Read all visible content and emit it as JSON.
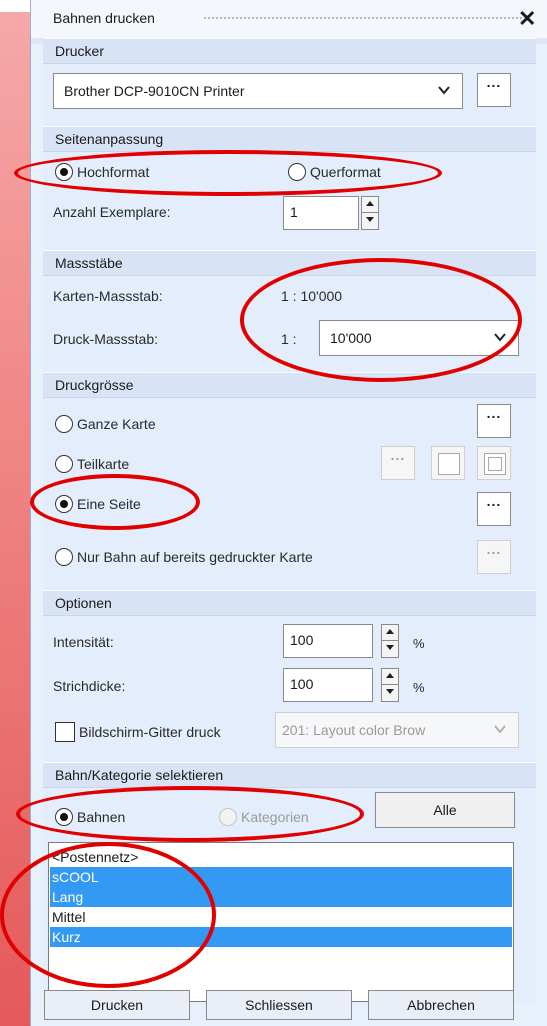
{
  "window": {
    "title": "Bahnen drucken"
  },
  "printer": {
    "section_title": "Drucker",
    "selected": "Brother DCP-9010CN Printer",
    "more_label": "..."
  },
  "page_setup": {
    "section_title": "Seitenanpassung",
    "portrait_label": "Hochformat",
    "landscape_label": "Querformat",
    "orientation_selected": "portrait",
    "copies_label": "Anzahl Exemplare:",
    "copies_value": "1"
  },
  "scales": {
    "section_title": "Massstäbe",
    "map_scale_label": "Karten-Massstab:",
    "map_scale_value": "1 : 10'000",
    "print_scale_label": "Druck-Massstab:",
    "print_scale_prefix": "1 :",
    "print_scale_value": "10'000"
  },
  "print_size": {
    "section_title": "Druckgrösse",
    "whole_map_label": "Ganze Karte",
    "partial_map_label": "Teilkarte",
    "one_page_label": "Eine Seite",
    "course_only_label": "Nur Bahn auf bereits gedruckter Karte",
    "selected": "one_page",
    "more_label": "...",
    "more_disabled_label": "..."
  },
  "options": {
    "section_title": "Optionen",
    "intensity_label": "Intensität:",
    "intensity_value": "100",
    "intensity_unit": "%",
    "line_width_label": "Strichdicke:",
    "line_width_value": "100",
    "line_width_unit": "%",
    "grid_label": "Bildschirm-Gitter druck",
    "grid_checked": false,
    "grid_color_value": "201: Layout color Brow"
  },
  "selection": {
    "section_title": "Bahn/Kategorie selektieren",
    "courses_label": "Bahnen",
    "categories_label": "Kategorien",
    "all_button": "Alle",
    "items": [
      {
        "label": "<Postennetz>",
        "selected": false
      },
      {
        "label": "sCOOL",
        "selected": true
      },
      {
        "label": "Lang",
        "selected": true
      },
      {
        "label": "Mittel",
        "selected": false
      },
      {
        "label": "Kurz",
        "selected": true
      }
    ]
  },
  "footer": {
    "print_button": "Drucken",
    "close_button": "Schliessen",
    "cancel_button": "Abbrechen"
  },
  "colors": {
    "annotation": "#e00000",
    "selection_highlight": "#3399f3",
    "panel_bg": "#e4edfb"
  }
}
